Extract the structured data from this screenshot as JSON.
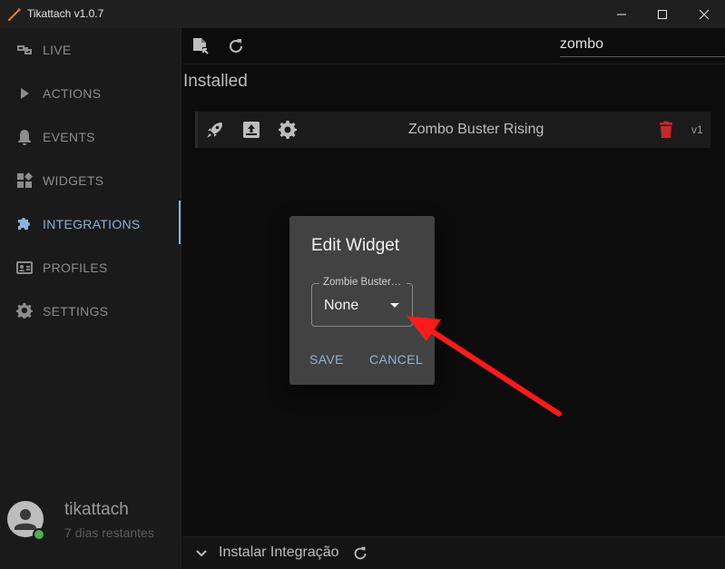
{
  "window": {
    "title": "Tikattach v1.0.7"
  },
  "sidebar": {
    "items": [
      {
        "label": "LIVE",
        "icon": "live-icon"
      },
      {
        "label": "ACTIONS",
        "icon": "play-icon"
      },
      {
        "label": "EVENTS",
        "icon": "bell-icon"
      },
      {
        "label": "WIDGETS",
        "icon": "widgets-icon"
      },
      {
        "label": "INTEGRATIONS",
        "icon": "puzzle-icon",
        "active": true
      },
      {
        "label": "PROFILES",
        "icon": "profile-card-icon"
      },
      {
        "label": "SETTINGS",
        "icon": "gear-icon"
      }
    ],
    "user": {
      "name": "tikattach",
      "subtitle": "7 dias restantes"
    }
  },
  "toolbar": {
    "search_value": "zombo"
  },
  "main": {
    "section_title": "Installed",
    "integration": {
      "name": "Zombo Buster Rising",
      "version": "v1"
    },
    "bottom_bar": {
      "label": "Instalar Integração"
    }
  },
  "dialog": {
    "title": "Edit Widget",
    "select_label": "Zombie Buster Rising",
    "select_value": "None",
    "save_label": "SAVE",
    "cancel_label": "CANCEL"
  },
  "colors": {
    "accent": "#8ab4d8",
    "delete": "#c62828",
    "arrow": "#ff1a1a",
    "online": "#4caf50"
  }
}
